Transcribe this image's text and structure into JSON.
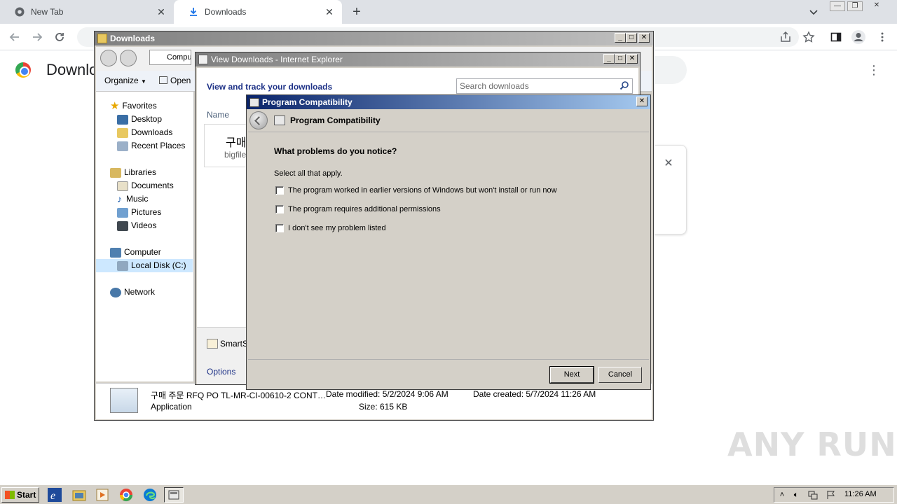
{
  "chrome": {
    "tabs": [
      {
        "title": "New Tab",
        "icon": "chrome-icon",
        "active": false
      },
      {
        "title": "Downloads",
        "icon": "download-icon",
        "active": true
      }
    ],
    "page_heading": "Downlo"
  },
  "explorer": {
    "title": "Downloads",
    "address": "Compu",
    "commands": {
      "organize": "Organize",
      "open": "Open"
    },
    "nav": {
      "favorites": "Favorites",
      "desktop": "Desktop",
      "downloads": "Downloads",
      "recent": "Recent Places",
      "libraries": "Libraries",
      "documents": "Documents",
      "music": "Music",
      "pictures": "Pictures",
      "videos": "Videos",
      "computer": "Computer",
      "local_disk": "Local Disk (C:)",
      "network": "Network"
    },
    "details": {
      "filename": "구매 주문 RFQ PO TL-MR-CI-00610-2 CONT…",
      "type": "Application",
      "modified_label": "Date modified: 5/2/2024 9:06 AM",
      "created_label": "Date created: 5/7/2024 11:26 AM",
      "size_label": "Size: 615 KB"
    }
  },
  "ie_downloads": {
    "title": "View Downloads - Internet Explorer",
    "heading": "View and track your downloads",
    "search_placeholder": "Search downloads",
    "column_name": "Name",
    "item_name": "구매",
    "item_sub": "bigfile-",
    "smartscreen": "SmartS",
    "options": "Options"
  },
  "compat_dialog": {
    "title": "Program Compatibility",
    "header_title": "Program Compatibility",
    "question": "What problems do you notice?",
    "instruction": "Select all that apply.",
    "options": [
      "The program worked in earlier versions of Windows but won't install or run now",
      "The program requires additional permissions",
      "I don't see my problem listed"
    ],
    "next_label": "Next",
    "cancel_label": "Cancel"
  },
  "taskbar": {
    "start_label": "Start",
    "clock": "11:26 AM"
  },
  "watermark": "ANY RUN",
  "colors": {
    "dialog_title_start": "#0a246a",
    "dialog_title_end": "#a6caf0",
    "inactive_title_start": "#808080",
    "link_blue": "#1e3287",
    "classic_face": "#d4d0c8"
  }
}
